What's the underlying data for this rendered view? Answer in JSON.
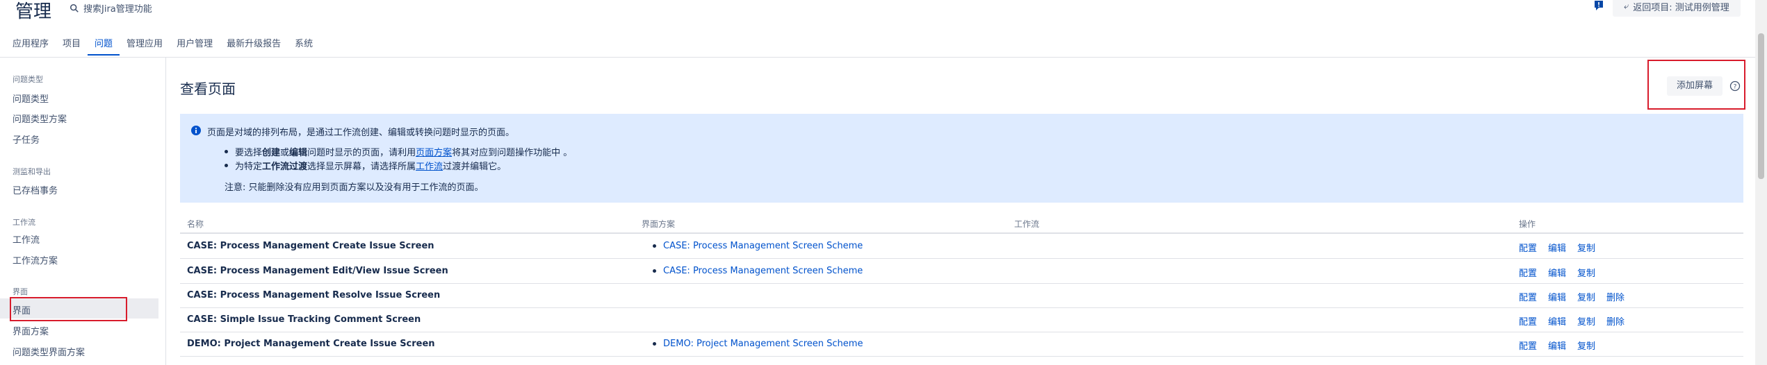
{
  "header": {
    "title": "管理",
    "search_label": "搜索Jira管理功能",
    "return_label": "返回项目: 测试用例管理"
  },
  "tabs": [
    {
      "label": "应用程序"
    },
    {
      "label": "项目"
    },
    {
      "label": "问题",
      "active": true
    },
    {
      "label": "管理应用"
    },
    {
      "label": "用户管理"
    },
    {
      "label": "最新升级报告"
    },
    {
      "label": "系统"
    }
  ],
  "sidebar": {
    "sections": [
      {
        "heading": "问题类型",
        "items": [
          "问题类型",
          "问题类型方案",
          "子任务"
        ]
      },
      {
        "heading": "测监和导出",
        "items": [
          "已存档事务"
        ]
      },
      {
        "heading": "工作流",
        "items": [
          "工作流",
          "工作流方案"
        ]
      },
      {
        "heading": "界面",
        "items": [
          "界面",
          "界面方案",
          "问题类型界面方案"
        ]
      }
    ],
    "active_item": "界面"
  },
  "main": {
    "title": "查看页面",
    "add_button": "添加屏幕",
    "info": {
      "line1": "页面是对域的排列布局，是通过工作流创建、编辑或转换问题时显示的页面。",
      "bullet1_a": "要选择",
      "bullet1_b": "创建",
      "bullet1_c": "或",
      "bullet1_d": "编辑",
      "bullet1_e": "问题时显示的页面，请利用",
      "bullet1_link": "页面方案",
      "bullet1_f": "将其对应到问题操作功能中 。",
      "bullet2_a": "为特定",
      "bullet2_b": "工作流过渡",
      "bullet2_c": "选择显示屏幕，请选择所属",
      "bullet2_link": "工作流",
      "bullet2_d": "过渡并编辑它。",
      "note": "注意: 只能删除没有应用到页面方案以及没有用于工作流的页面。"
    },
    "table": {
      "headers": {
        "name": "名称",
        "scheme": "界面方案",
        "workflow": "工作流",
        "ops": "操作"
      },
      "rows": [
        {
          "name": "CASE: Process Management Create Issue Screen",
          "scheme": "CASE: Process Management Screen Scheme",
          "ops": [
            "配置",
            "编辑",
            "复制"
          ]
        },
        {
          "name": "CASE: Process Management Edit/View Issue Screen",
          "scheme": "CASE: Process Management Screen Scheme",
          "ops": [
            "配置",
            "编辑",
            "复制"
          ]
        },
        {
          "name": "CASE: Process Management Resolve Issue Screen",
          "scheme": "",
          "ops": [
            "配置",
            "编辑",
            "复制",
            "删除"
          ]
        },
        {
          "name": "CASE: Simple Issue Tracking Comment Screen",
          "scheme": "",
          "ops": [
            "配置",
            "编辑",
            "复制",
            "删除"
          ]
        },
        {
          "name": "DEMO: Project Management Create Issue Screen",
          "scheme": "DEMO: Project Management Screen Scheme",
          "ops": [
            "配置",
            "编辑",
            "复制"
          ]
        }
      ]
    }
  },
  "colors": {
    "accent": "#0052cc",
    "highlight": "#d81c2c",
    "info_bg": "#deebff"
  }
}
